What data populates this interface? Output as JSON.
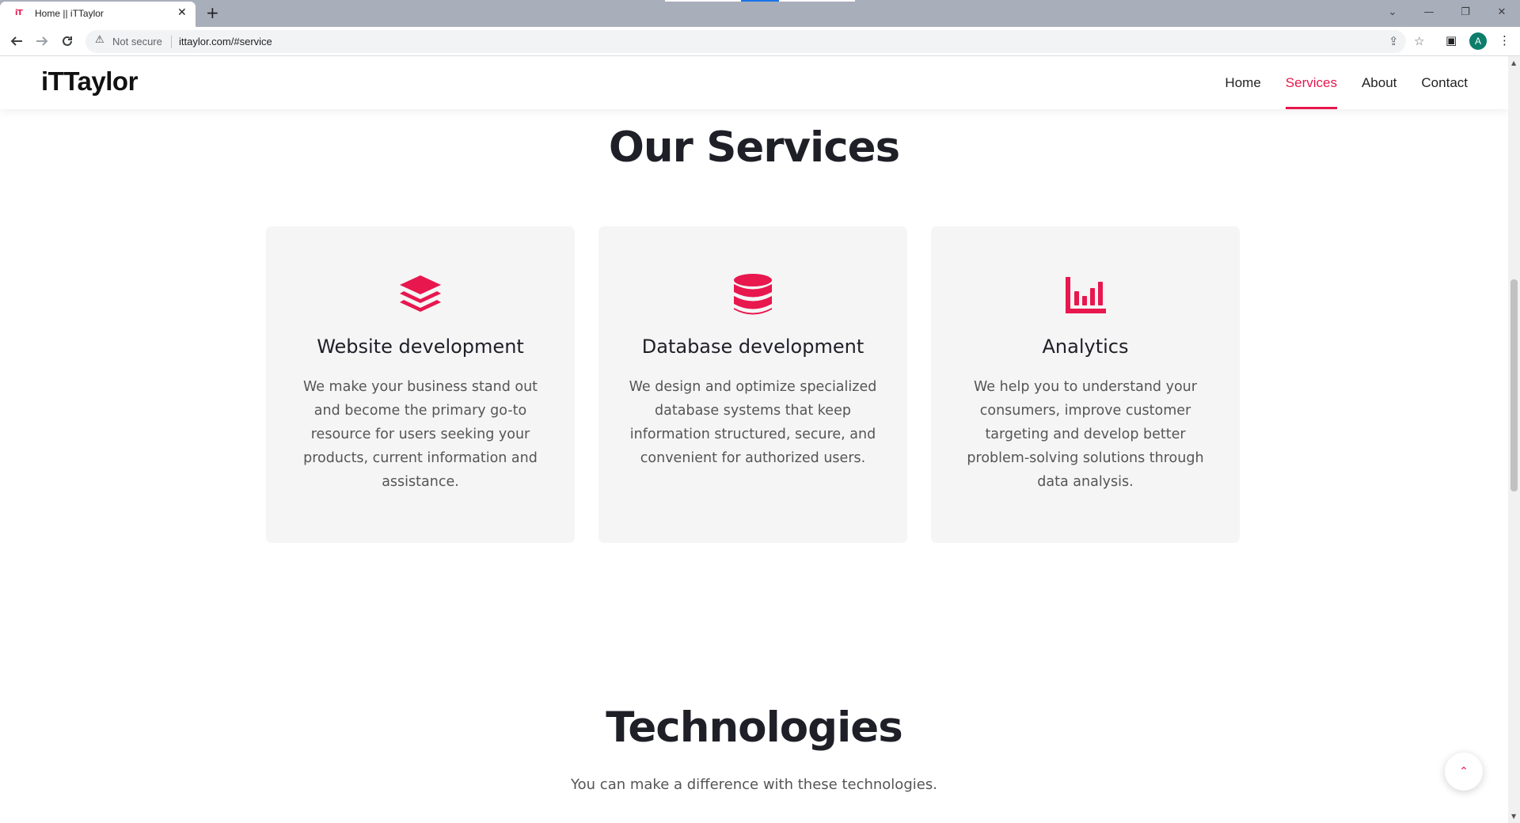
{
  "browser": {
    "tab_title": "Home || iTTaylor",
    "tab_favicon": "iT",
    "security_label": "Not secure",
    "url": "ittaylor.com/#service",
    "profile_initial": "A"
  },
  "site": {
    "logo": "iTTaylor",
    "nav": [
      {
        "label": "Home",
        "active": false
      },
      {
        "label": "Services",
        "active": true
      },
      {
        "label": "About",
        "active": false
      },
      {
        "label": "Contact",
        "active": false
      }
    ],
    "accent_color": "#e8174e"
  },
  "services": {
    "title": "Our Services",
    "cards": [
      {
        "icon": "layers-icon",
        "title": "Website development",
        "description": "We make your business stand out and become the primary go-to resource for users seeking your products, current information and assistance."
      },
      {
        "icon": "database-icon",
        "title": "Database development",
        "description": "We design and optimize specialized database systems that keep information structured, secure, and convenient for authorized users."
      },
      {
        "icon": "bar-chart-icon",
        "title": "Analytics",
        "description": "We help you to understand your consumers, improve customer targeting and develop better problem-solving solutions through data analysis."
      }
    ]
  },
  "technologies": {
    "title": "Technologies",
    "subtitle": "You can make a difference with these technologies."
  }
}
